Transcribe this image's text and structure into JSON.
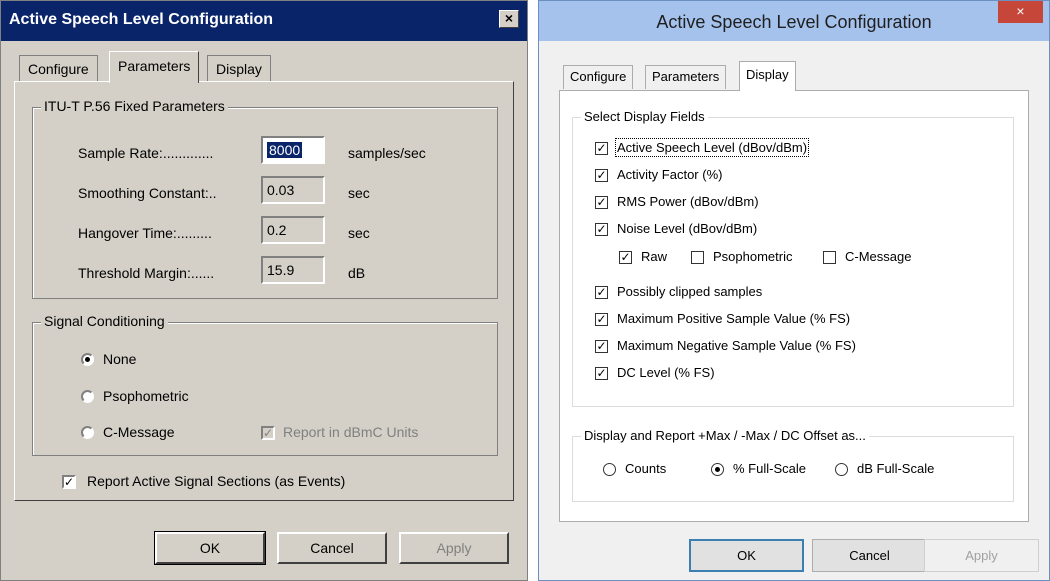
{
  "left_window": {
    "title": "Active Speech Level Configuration",
    "close_glyph": "×",
    "tabs": [
      "Configure",
      "Parameters",
      "Display"
    ],
    "active_tab": "Parameters",
    "fixed_params": {
      "legend": "ITU-T P.56 Fixed Parameters",
      "rows": [
        {
          "label": "Sample Rate:.............",
          "value": "8000",
          "unit": "samples/sec"
        },
        {
          "label": "Smoothing Constant:..",
          "value": "0.03",
          "unit": "sec"
        },
        {
          "label": "Hangover Time:.........",
          "value": "0.2",
          "unit": "sec"
        },
        {
          "label": "Threshold Margin:......",
          "value": "15.9",
          "unit": "dB"
        }
      ]
    },
    "signal_conditioning": {
      "legend": "Signal Conditioning",
      "options": [
        "None",
        "Psophometric",
        "C-Message"
      ],
      "selected": "None",
      "report_dbmc_label": "Report in dBmC Units",
      "report_dbmc_checked": true
    },
    "report_events_label": "Report Active Signal Sections (as Events)",
    "report_events_checked": true,
    "buttons": {
      "ok": "OK",
      "cancel": "Cancel",
      "apply": "Apply"
    }
  },
  "right_window": {
    "title": "Active Speech Level Configuration",
    "close_glyph": "×",
    "tabs": [
      "Configure",
      "Parameters",
      "Display"
    ],
    "active_tab": "Display",
    "display_fields": {
      "legend": "Select Display Fields",
      "items": [
        "Active Speech Level (dBov/dBm)",
        "Activity Factor (%)",
        "RMS Power (dBov/dBm)",
        "Noise Level (dBov/dBm)"
      ],
      "noise_sub": [
        {
          "label": "Raw",
          "checked": true
        },
        {
          "label": "Psophometric",
          "checked": false
        },
        {
          "label": "C-Message",
          "checked": false
        }
      ],
      "items2": [
        "Possibly clipped samples",
        "Maximum Positive Sample Value (% FS)",
        "Maximum Negative Sample Value (% FS)",
        "DC Level (% FS)"
      ]
    },
    "report_as": {
      "legend": "Display and Report +Max / -Max / DC Offset as...",
      "options": [
        "Counts",
        "% Full-Scale",
        "dB Full-Scale"
      ],
      "selected": "% Full-Scale"
    },
    "buttons": {
      "ok": "OK",
      "cancel": "Cancel",
      "apply": "Apply"
    }
  }
}
